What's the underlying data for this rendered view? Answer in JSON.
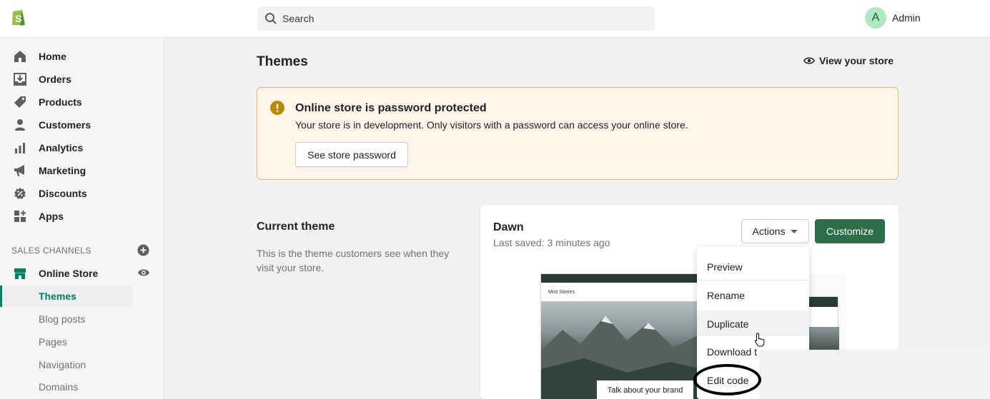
{
  "topbar": {
    "search_placeholder": "Search",
    "user_initial": "A",
    "user_name": "Admin"
  },
  "sidebar": {
    "items": [
      {
        "label": "Home",
        "icon": "home-icon"
      },
      {
        "label": "Orders",
        "icon": "orders-icon"
      },
      {
        "label": "Products",
        "icon": "tag-icon"
      },
      {
        "label": "Customers",
        "icon": "person-icon"
      },
      {
        "label": "Analytics",
        "icon": "bar-chart-icon"
      },
      {
        "label": "Marketing",
        "icon": "megaphone-icon"
      },
      {
        "label": "Discounts",
        "icon": "discount-icon"
      },
      {
        "label": "Apps",
        "icon": "apps-icon"
      }
    ],
    "sales_channels_label": "SALES CHANNELS",
    "online_store_label": "Online Store",
    "sub_items": [
      "Themes",
      "Blog posts",
      "Pages",
      "Navigation",
      "Domains"
    ]
  },
  "main": {
    "title": "Themes",
    "view_store": "View your store",
    "banner": {
      "title": "Online store is password protected",
      "text": "Your store is in development. Only visitors with a password can access your online store.",
      "button": "See store password"
    },
    "current_theme": {
      "heading": "Current theme",
      "description": "This is the theme customers see when they visit your store.",
      "theme_name": "Dawn",
      "last_saved": "Last saved: 3 minutes ago",
      "actions_label": "Actions",
      "customize_label": "Customize",
      "preview_store_name": "Mint Stories",
      "preview_brand_text": "Talk about your brand"
    },
    "actions_menu": [
      "Preview",
      "Rename",
      "Duplicate",
      "Download t",
      "Edit code"
    ]
  },
  "colors": {
    "accent": "#008060",
    "primary_button": "#2c6e49",
    "banner_bg": "#fff5ea",
    "banner_border": "#e1b878",
    "warning_icon": "#b98900"
  }
}
